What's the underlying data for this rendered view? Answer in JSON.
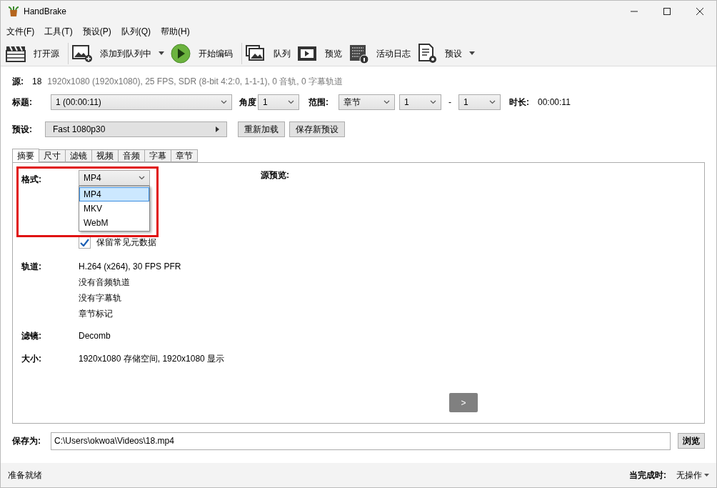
{
  "window": {
    "title": "HandBrake"
  },
  "menu": [
    "文件(F)",
    "工具(T)",
    "预设(P)",
    "队列(Q)",
    "帮助(H)"
  ],
  "toolbar": [
    {
      "label": "打开源",
      "dropdown": false
    },
    {
      "label": "添加到队列中",
      "dropdown": true
    },
    {
      "label": "开始编码",
      "dropdown": false
    },
    {
      "label": "队列",
      "dropdown": false
    },
    {
      "label": "预览",
      "dropdown": false
    },
    {
      "label": "活动日志",
      "dropdown": false
    },
    {
      "label": "预设",
      "dropdown": true
    }
  ],
  "source": {
    "label": "源:",
    "name": "18",
    "info": "1920x1080 (1920x1080), 25 FPS, SDR (8-bit 4:2:0, 1-1-1), 0 音轨, 0 字幕轨道"
  },
  "title_row": {
    "title_label": "标题:",
    "title_value": "1  (00:00:11)",
    "angle_label": "角度",
    "angle_value": "1",
    "range_label": "范围:",
    "range_type": "章节",
    "range_from": "1",
    "range_sep": "-",
    "range_to": "1",
    "duration_label": "时长:",
    "duration": "00:00:11"
  },
  "preset_row": {
    "label": "预设:",
    "value": "Fast 1080p30",
    "buttons": [
      "重新加载",
      "保存新预设"
    ]
  },
  "tabs": [
    {
      "label": "摘要",
      "selected": true
    },
    {
      "label": "尺寸",
      "selected": false
    },
    {
      "label": "滤镜",
      "selected": false
    },
    {
      "label": "视频",
      "selected": false
    },
    {
      "label": "音频",
      "selected": false
    },
    {
      "label": "字幕",
      "selected": false
    },
    {
      "label": "章节",
      "selected": false
    }
  ],
  "summary": {
    "format_label": "格式:",
    "format_value": "MP4",
    "format_options": [
      {
        "label": "MP4",
        "selected": true
      },
      {
        "label": "MKV",
        "selected": false
      },
      {
        "label": "WebM",
        "selected": false
      }
    ],
    "metadata_checkbox": {
      "label": "保留常见元数据",
      "checked": true
    },
    "tracks_label": "轨道:",
    "tracks": [
      "H.264 (x264), 30 FPS PFR",
      "没有音频轨道",
      "没有字幕轨",
      "章节标记"
    ],
    "filters_label": "滤镜:",
    "filters": "Decomb",
    "size_label": "大小:",
    "size": "1920x1080 存储空间, 1920x1080 显示",
    "preview_label": "源预览:",
    "next_button": ">"
  },
  "save": {
    "label": "保存为:",
    "value": "C:\\Users\\okwoa\\Videos\\18.mp4",
    "browse": "浏览"
  },
  "status_bar": {
    "status": "准备就绪",
    "when_done_label": "当完成时:",
    "when_done": "无操作"
  }
}
